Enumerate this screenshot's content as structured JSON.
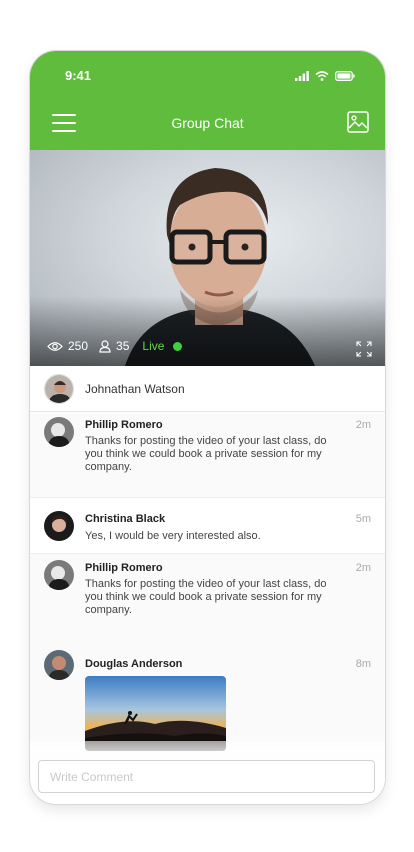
{
  "status_bar": {
    "time": "9:41"
  },
  "header": {
    "title": "Group Chat",
    "menu_icon": "hamburger-menu-icon",
    "gallery_icon": "image-gallery-icon"
  },
  "video": {
    "views": "250",
    "participants": "35",
    "live_label": "Live",
    "colors": {
      "live": "#3ed13b"
    }
  },
  "host": {
    "name": "Johnathan Watson"
  },
  "messages": [
    {
      "name": "Phillip Romero",
      "text": "Thanks for posting the video of your last class, do you think we could book a private session for my company.",
      "time": "2m"
    },
    {
      "name": "Christina Black",
      "text": "Yes, I would be very interested also.",
      "time": "5m"
    },
    {
      "name": "Phillip Romero",
      "text": "Thanks for posting the video of your last class, do you think we could book a private session for my company.",
      "time": "2m"
    },
    {
      "name": "Douglas Anderson",
      "text": "",
      "time": "8m"
    }
  ],
  "comment": {
    "placeholder": "Write Comment"
  },
  "colors": {
    "brand": "#5fbc3c"
  }
}
